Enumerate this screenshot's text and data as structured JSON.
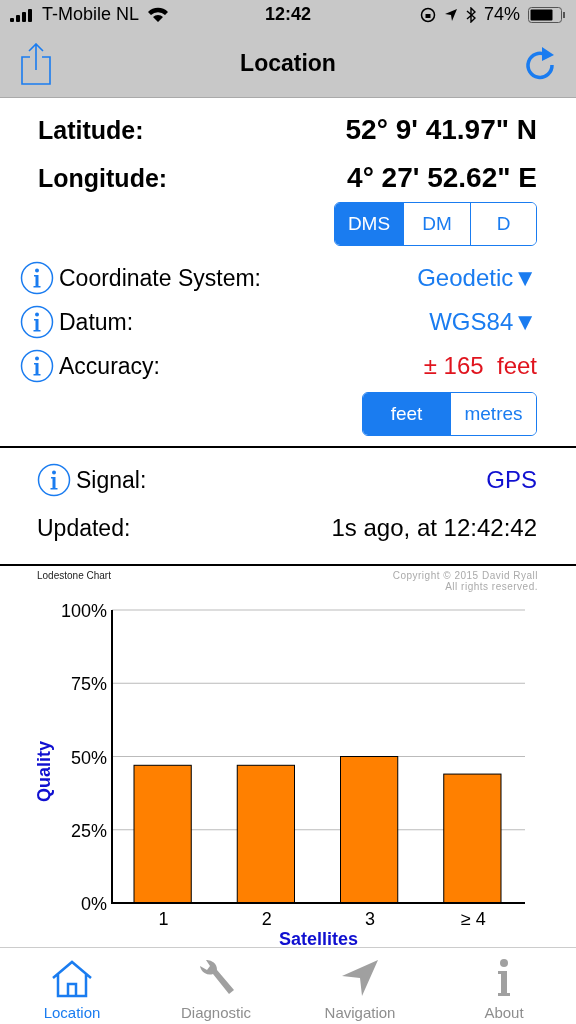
{
  "status_bar": {
    "carrier": "T-Mobile NL",
    "time": "12:42",
    "battery": "74%"
  },
  "nav_bar": {
    "title": "Location"
  },
  "coordinates": [
    {
      "label": "Latitude:",
      "value": "52° 9' 41.97\" N"
    },
    {
      "label": "Longitude:",
      "value": "4° 27' 52.62\" E"
    }
  ],
  "format_segments": [
    {
      "label": "DMS",
      "selected": true
    },
    {
      "label": "DM",
      "selected": false
    },
    {
      "label": "D",
      "selected": false
    }
  ],
  "settings": [
    {
      "label": "Coordinate System:",
      "value": "Geodetic▼",
      "kind": "picker"
    },
    {
      "label": "Datum:",
      "value": "WGS84▼",
      "kind": "picker"
    },
    {
      "label": "Accuracy:",
      "value": "± 165  feet",
      "kind": "warning"
    }
  ],
  "unit_segments": [
    {
      "label": "feet",
      "selected": true
    },
    {
      "label": "metres",
      "selected": false
    }
  ],
  "signal": {
    "label": "Signal:",
    "value": "GPS"
  },
  "updated": {
    "label": "Updated:",
    "value": "1s ago, at 12:42:42"
  },
  "chart": {
    "title": "Lodestone Chart",
    "copyright": "Copyright © 2015 David Ryall",
    "rights": "All rights reserved.",
    "chart_data": {
      "type": "bar",
      "xlabel": "Satellites",
      "ylabel": "Quality",
      "categories": [
        "1",
        "2",
        "3",
        "≥ 4"
      ],
      "series": [
        {
          "color": "#ff8000",
          "values": [
            47,
            47,
            50,
            44
          ]
        }
      ],
      "grid": true,
      "ylim": [
        0,
        100
      ],
      "yticks": [
        {
          "value": 0,
          "label": "0%"
        },
        {
          "value": 25,
          "label": "25%"
        },
        {
          "value": 50,
          "label": "50%"
        },
        {
          "value": 75,
          "label": "75%"
        },
        {
          "value": 100,
          "label": "100%"
        }
      ]
    }
  },
  "tab_bar": [
    {
      "label": "Location",
      "kind": "home",
      "selected": true
    },
    {
      "label": "Diagnostic",
      "kind": "wrench",
      "selected": false
    },
    {
      "label": "Navigation",
      "kind": "arrow",
      "selected": false
    },
    {
      "label": "About",
      "kind": "info",
      "selected": false
    }
  ]
}
